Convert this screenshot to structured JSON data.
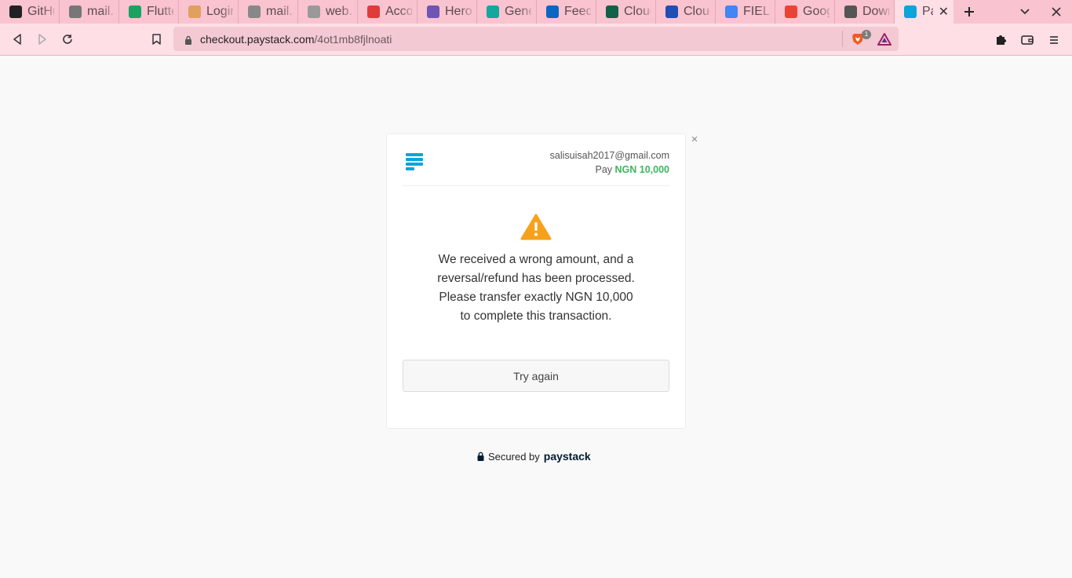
{
  "browser": {
    "tabs": [
      {
        "label": "GitHu",
        "icon": "github-icon",
        "color": "#222222",
        "active": false
      },
      {
        "label": "mail.c",
        "icon": "globe-icon",
        "color": "#777777",
        "active": false
      },
      {
        "label": "Flutte",
        "icon": "flutterwave-icon",
        "color": "#1aa260",
        "active": false
      },
      {
        "label": "Login",
        "icon": "leaf-icon",
        "color": "#e0a060",
        "active": false
      },
      {
        "label": "mail.g",
        "icon": "gmail-icon",
        "color": "#888888",
        "active": false
      },
      {
        "label": "web.f",
        "icon": "facebook-icon",
        "color": "#999999",
        "active": false
      },
      {
        "label": "Accou",
        "icon": "account-icon",
        "color": "#e03b3b",
        "active": false
      },
      {
        "label": "Herok",
        "icon": "heroku-icon",
        "color": "#6f55b4",
        "active": false
      },
      {
        "label": "Gener",
        "icon": "diamond-icon",
        "color": "#13a89e",
        "active": false
      },
      {
        "label": "Feed",
        "icon": "linkedin-icon",
        "color": "#0a66c2",
        "active": false
      },
      {
        "label": "Cloud",
        "icon": "mongodb-icon",
        "color": "#116149",
        "active": false
      },
      {
        "label": "Cloud",
        "icon": "cloud-icon",
        "color": "#1f4fb5",
        "active": false
      },
      {
        "label": "FIELD",
        "icon": "docs-icon",
        "color": "#4285f4",
        "active": false
      },
      {
        "label": "Goog",
        "icon": "google-icon",
        "color": "#ea4335",
        "active": false
      },
      {
        "label": "Down",
        "icon": "download-icon",
        "color": "#555555",
        "active": false
      },
      {
        "label": "Pay",
        "icon": "paystack-icon",
        "color": "#0ba4db",
        "active": true
      }
    ],
    "url": {
      "host": "checkout.paystack.com",
      "path": "/4ot1mb8fjlnoati"
    },
    "shields_badge": "1"
  },
  "checkout": {
    "email": "salisuisah2017@gmail.com",
    "pay_label": "Pay",
    "amount": "NGN 10,000",
    "message": "We received a wrong amount, and a reversal/refund has been processed. Please transfer exactly NGN 10,000 to complete this transaction.",
    "try_again": "Try again",
    "close": "×"
  },
  "footer": {
    "secured_by": "Secured by",
    "brand": "paystack"
  },
  "colors": {
    "accent_green": "#3bb75e",
    "paystack_blue": "#0ba4db",
    "warning_orange": "#f7a11b",
    "tabstrip_bg": "#f9c3cf",
    "toolbar_bg": "#ffdfe6"
  }
}
